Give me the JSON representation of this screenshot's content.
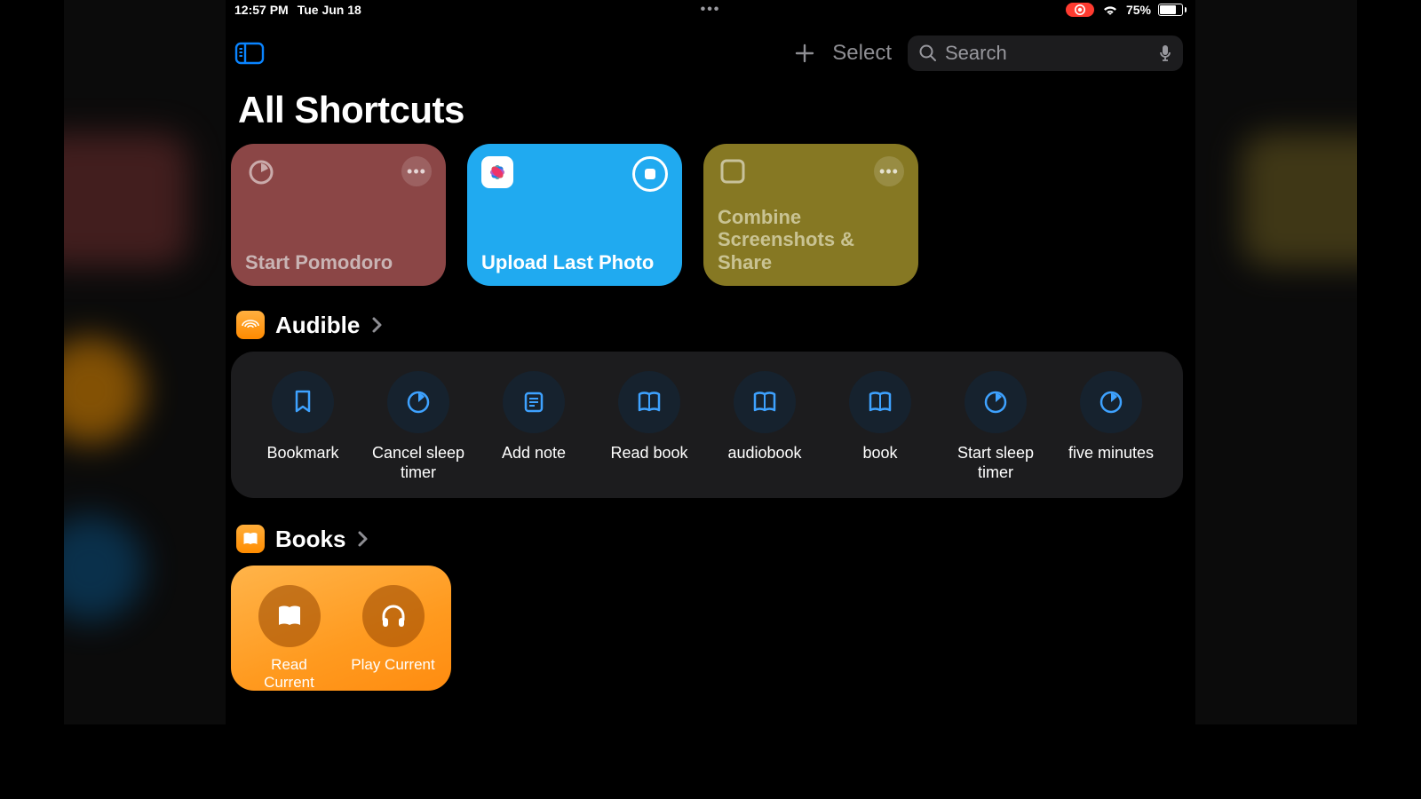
{
  "status": {
    "time": "12:57 PM",
    "date": "Tue Jun 18",
    "recording": true,
    "wifi": true,
    "battery_percent": "75%",
    "battery_fill": 0.75
  },
  "toolbar": {
    "select_label": "Select",
    "search_placeholder": "Search"
  },
  "page_title": "All Shortcuts",
  "tiles": [
    {
      "id": "start-pomodoro",
      "label": "Start Pomodoro",
      "color": "red",
      "icon": "timer"
    },
    {
      "id": "upload-last-photo",
      "label": "Upload Last Photo",
      "color": "blue",
      "icon": "photos",
      "running": true
    },
    {
      "id": "combine-screenshots",
      "label": "Combine Screenshots & Share",
      "color": "yellow",
      "icon": "square"
    }
  ],
  "sections": {
    "audible": {
      "title": "Audible",
      "items": [
        {
          "label": "Bookmark",
          "icon": "bookmark"
        },
        {
          "label": "Cancel sleep timer",
          "icon": "timer"
        },
        {
          "label": "Add note",
          "icon": "note"
        },
        {
          "label": "Read book",
          "icon": "book"
        },
        {
          "label": "audiobook",
          "icon": "book"
        },
        {
          "label": "book",
          "icon": "book"
        },
        {
          "label": "Start sleep timer",
          "icon": "timer"
        },
        {
          "label": "five minutes",
          "icon": "timer"
        }
      ]
    },
    "books": {
      "title": "Books",
      "items": [
        {
          "label": "Read Current",
          "icon": "book"
        },
        {
          "label": "Play Current",
          "icon": "headphones"
        }
      ]
    }
  }
}
